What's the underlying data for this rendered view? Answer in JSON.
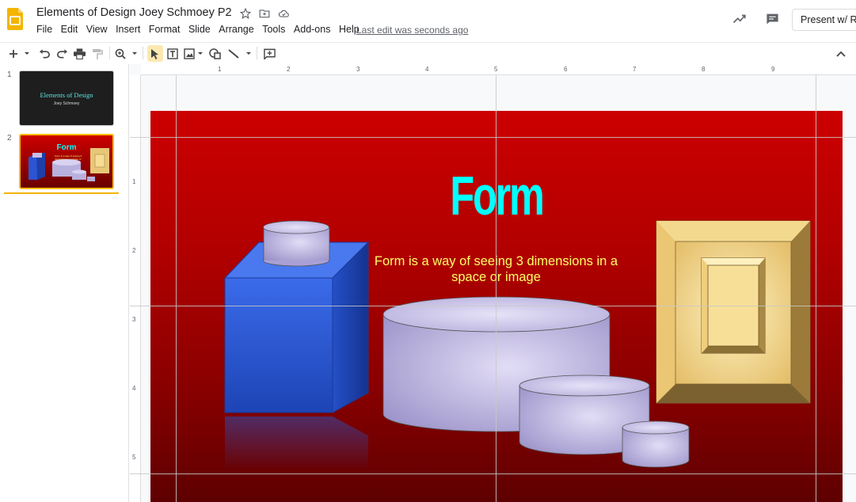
{
  "header": {
    "doc_title": "Elements of Design Joey Schmoey P2",
    "last_edit": "Last edit was seconds ago",
    "present_label": "Present w/ Re"
  },
  "menu": [
    "File",
    "Edit",
    "View",
    "Insert",
    "Format",
    "Slide",
    "Arrange",
    "Tools",
    "Add-ons",
    "Help"
  ],
  "filmstrip": {
    "slides": [
      {
        "number": "1",
        "title": "Elements of Design",
        "subtitle": "Joey Schmoey"
      },
      {
        "number": "2",
        "title": "Form",
        "subtitle": "Form is a way of seeing 3 dimensions in a space or image"
      }
    ]
  },
  "ruler": {
    "top_labels": [
      "1",
      "2",
      "3",
      "4",
      "5",
      "6",
      "7",
      "8",
      "9"
    ],
    "left_labels": [
      "1",
      "2",
      "3",
      "4",
      "5"
    ]
  },
  "slide": {
    "title": "Form",
    "subtitle": "Form is a way of seeing 3 dimensions in a space or image"
  },
  "colors": {
    "accent": "#fbbc04",
    "title_color": "#00ffff",
    "subtitle_color": "#ffff66",
    "slide_bg": "#cc0000"
  },
  "icons": {
    "logo": "slides-logo-icon",
    "star": "star-icon",
    "folder": "move-to-folder-icon",
    "cloud": "cloud-status-icon",
    "trend": "activity-trend-icon",
    "comment": "comment-icon"
  }
}
